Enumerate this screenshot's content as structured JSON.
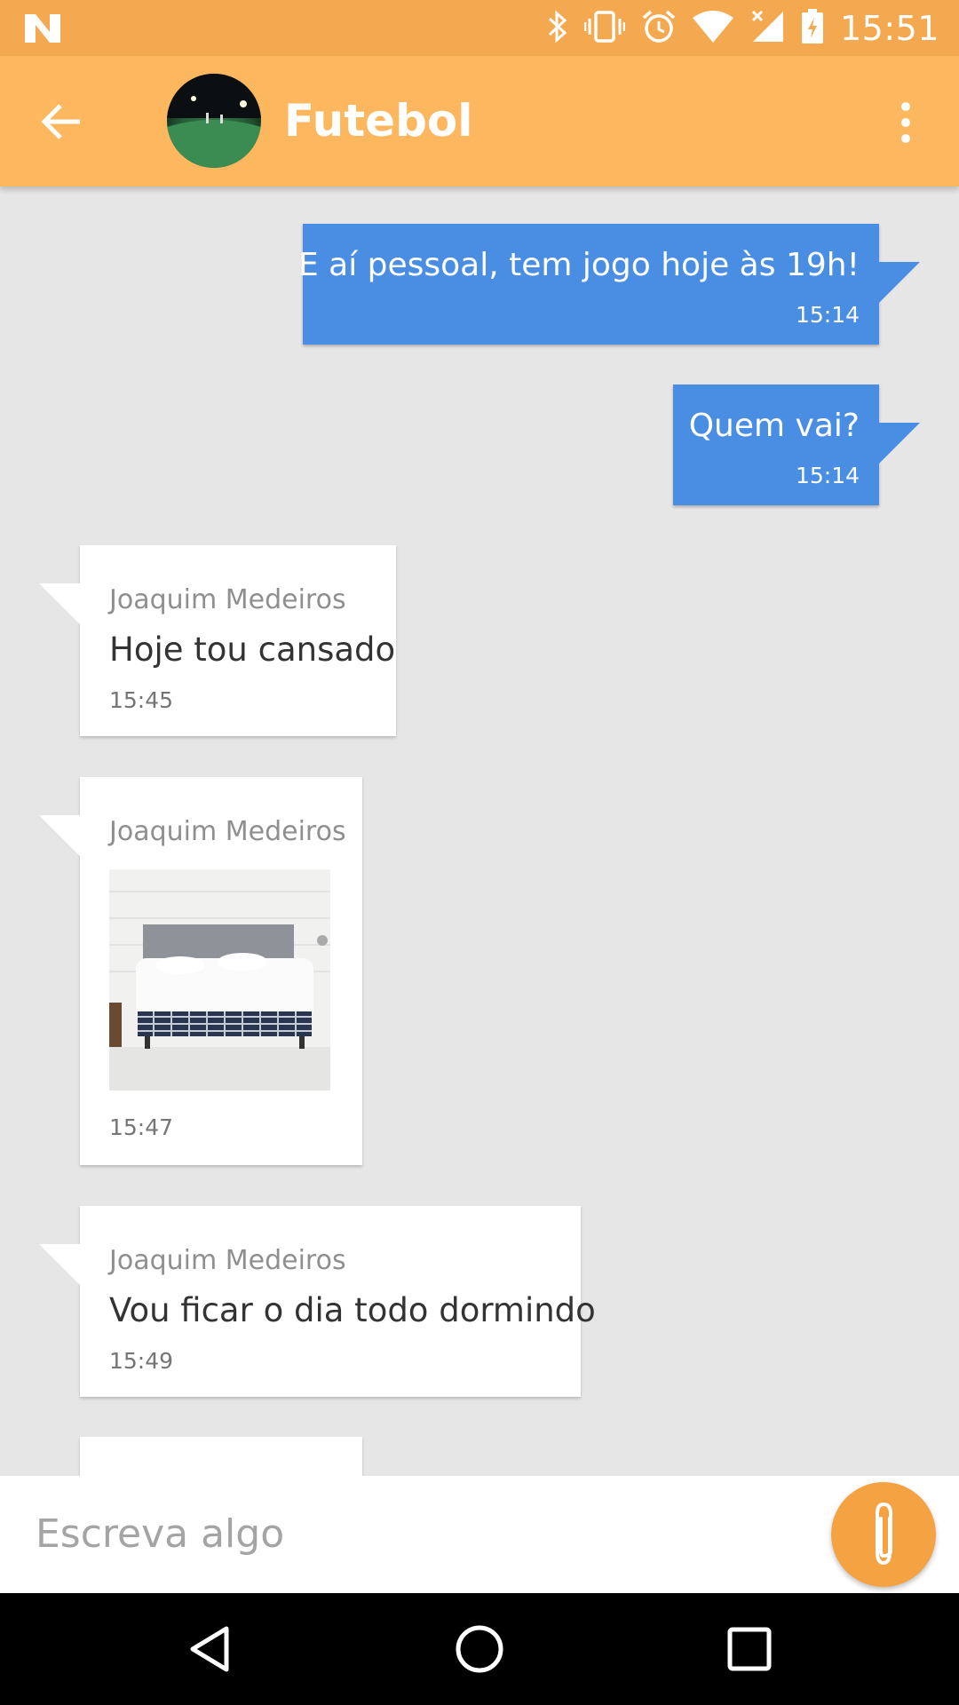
{
  "status_bar": {
    "time": "15:51",
    "icons": [
      "notification-n-icon",
      "bluetooth-icon",
      "vibrate-icon",
      "alarm-icon",
      "wifi-icon",
      "signal-icon",
      "battery-charging-icon"
    ]
  },
  "app_bar": {
    "title": "Futebol",
    "back_icon": "arrow-back-icon",
    "menu_icon": "more-vert-icon"
  },
  "messages": [
    {
      "direction": "outgoing",
      "text": "E aí pessoal, tem jogo hoje às 19h!",
      "time": "15:14"
    },
    {
      "direction": "outgoing",
      "text": "Quem vai?",
      "time": "15:14"
    },
    {
      "direction": "incoming",
      "sender": "Joaquim Medeiros",
      "text": "Hoje tou cansado",
      "time": "15:45"
    },
    {
      "direction": "incoming",
      "sender": "Joaquim Medeiros",
      "image": "bed-photo",
      "time": "15:47"
    },
    {
      "direction": "incoming",
      "sender": "Joaquim Medeiros",
      "text": "Vou ficar o dia todo dormindo",
      "time": "15:49"
    }
  ],
  "composer": {
    "placeholder": "Escreva algo",
    "value": "",
    "attach_icon": "paperclip-icon"
  },
  "colors": {
    "status_bar": "#f4a950",
    "app_bar": "#fdb75e",
    "outgoing_bubble": "#4a8ee3",
    "incoming_bubble": "#ffffff",
    "background": "#e6e6e6",
    "attach_button": "#f5a243"
  },
  "nav_bar": {
    "buttons": [
      "back-triangle-icon",
      "home-circle-icon",
      "recents-square-icon"
    ]
  }
}
